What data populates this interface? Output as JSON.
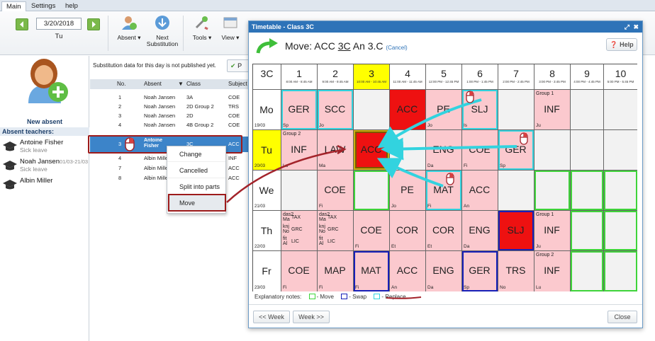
{
  "menu": {
    "tabs": [
      "Main",
      "Settings",
      "help"
    ]
  },
  "toolbar": {
    "date": "3/20/2018",
    "weekday": "Tu",
    "absent_label": "Absent",
    "next_substitution_label": "Next Substitution",
    "tools_label": "Tools",
    "view_label": "View"
  },
  "left": {
    "new_absent_label": "New absent",
    "absent_teachers_header": "Absent teachers:",
    "teachers": [
      {
        "name": "Antoine Fisher",
        "reason": "Sick leave",
        "dates": ""
      },
      {
        "name": "Noah Jansen",
        "reason": "Sick leave",
        "dates": "01/03-21/03"
      },
      {
        "name": "Albin Miller",
        "reason": "",
        "dates": ""
      }
    ]
  },
  "center": {
    "info": "Substitution data for this day is not published yet.",
    "publish_label": "P",
    "columns": [
      "No.",
      "Absent",
      "Class",
      "Subject"
    ],
    "rows": [
      {
        "no": "1",
        "absent": "Noah Jansen",
        "cls": "3A",
        "subject": "COE"
      },
      {
        "no": "2",
        "absent": "Noah Jansen",
        "cls": "2D Group 2",
        "subject": "TRS"
      },
      {
        "no": "3",
        "absent": "Noah Jansen",
        "cls": "2D",
        "subject": "COE"
      },
      {
        "no": "4",
        "absent": "Noah Jansen",
        "cls": "4B Group 2",
        "subject": "COE"
      },
      {
        "no": "3",
        "absent": "Antoine Fisher",
        "cls": "3C",
        "subject": "ACC"
      },
      {
        "no": "4",
        "absent": "Albin Mille",
        "cls": "",
        "subject": "INF"
      },
      {
        "no": "7",
        "absent": "Albin Mille",
        "cls": "",
        "subject": "ACC"
      },
      {
        "no": "8",
        "absent": "Albin Mille",
        "cls": "",
        "subject": "ACC"
      }
    ]
  },
  "context_menu": [
    "Change",
    "Cancelled",
    "Split into parts",
    "Move"
  ],
  "modal": {
    "title": "Timetable - Class 3C",
    "move_prefix": "Move: ACC ",
    "move_class": "3C",
    "move_suffix": " An 3.C ",
    "cancel_label": "(Cancel)",
    "help_label": "Help",
    "class_label": "3C",
    "periods": [
      {
        "n": "1",
        "t": "8:00 AM - 8:45 AM"
      },
      {
        "n": "2",
        "t": "9:00 AM - 9:45 AM"
      },
      {
        "n": "3",
        "t": "10:00 AM - 10:45 AM"
      },
      {
        "n": "4",
        "t": "11:00 AM - 11:45 AM"
      },
      {
        "n": "5",
        "t": "12:00 PM - 12:45 PM"
      },
      {
        "n": "6",
        "t": "1:00 PM - 1:45 PM"
      },
      {
        "n": "7",
        "t": "2:00 PM - 2:45 PM"
      },
      {
        "n": "8",
        "t": "3:00 PM - 3:45 PM"
      },
      {
        "n": "9",
        "t": "4:00 PM - 4:45 PM"
      },
      {
        "n": "10",
        "t": "5:00 PM - 5:45 PM"
      }
    ],
    "days": [
      {
        "d": "Mo",
        "date": "19/03"
      },
      {
        "d": "Tu",
        "date": "20/03"
      },
      {
        "d": "We",
        "date": "21/03"
      },
      {
        "d": "Th",
        "date": "22/03"
      },
      {
        "d": "Fr",
        "date": "23/03"
      }
    ],
    "lessons": {
      "mo1": {
        "s": "GER",
        "t": "Sp"
      },
      "mo2": {
        "s": "SCC",
        "t": "Jo"
      },
      "mo4": {
        "s": "ACC",
        "t": ""
      },
      "mo5": {
        "s": "PE",
        "t": "Jo"
      },
      "mo6": {
        "s": "SLJ",
        "t": "Is"
      },
      "mo8": {
        "s": "INF",
        "t": "Ju",
        "g": "Group 1"
      },
      "tu1": {
        "s": "INF",
        "t": "Lu",
        "g": "Group 2"
      },
      "tu2": {
        "s": "LAW",
        "t": "Ma"
      },
      "tu3": {
        "s": "ACC",
        "t": ""
      },
      "tu5": {
        "s": "ENG",
        "t": "Da"
      },
      "tu6": {
        "s": "COE",
        "t": "Fi"
      },
      "tu7": {
        "s": "GER",
        "t": "Sp"
      },
      "we2": {
        "s": "COE",
        "t": "Fi"
      },
      "we4": {
        "s": "PE",
        "t": "Jo"
      },
      "we5": {
        "s": "MAT",
        "t": "Fi"
      },
      "we6": {
        "s": "ACC",
        "t": "An"
      },
      "th3": {
        "s": "COE",
        "t": "Fi"
      },
      "th4": {
        "s": "COR",
        "t": "Et"
      },
      "th5": {
        "s": "COR",
        "t": "Et"
      },
      "th6": {
        "s": "ENG",
        "t": "Da"
      },
      "th7": {
        "s": "SLJ",
        "t": ""
      },
      "th8": {
        "s": "INF",
        "t": "Ju",
        "g": "Group 1"
      },
      "th1": {
        "a1": "das2",
        "a2": "TAX",
        "a3": "Ma",
        "b1": "knj",
        "b2": "GRC",
        "b3": "No",
        "c1": "fit",
        "c2": "LIC",
        "c3": "Al"
      },
      "th2": {
        "a1": "das2",
        "a2": "TAX",
        "a3": "Ma",
        "b1": "knj",
        "b2": "GRC",
        "b3": "No",
        "c1": "fit",
        "c2": "LIC",
        "c3": "Al"
      },
      "fr1": {
        "s": "COE",
        "t": "Fi"
      },
      "fr2": {
        "s": "MAP",
        "t": "Fi"
      },
      "fr3": {
        "s": "MAT",
        "t": "Fi"
      },
      "fr4": {
        "s": "ACC",
        "t": "An"
      },
      "fr5": {
        "s": "ENG",
        "t": "Da"
      },
      "fr6": {
        "s": "GER",
        "t": "Sp"
      },
      "fr7": {
        "s": "TRS",
        "t": "No"
      },
      "fr8": {
        "s": "INF",
        "t": "Lu",
        "g": "Group 2"
      }
    },
    "legend": {
      "label": "Explanatory notes:",
      "move": "- Move",
      "swap": "- Swap",
      "replace": "- Replace"
    },
    "prev_week": "<< Week",
    "next_week": "Week >>",
    "close": "Close"
  },
  "colors": {
    "accent": "#2e73b8",
    "lesson": "#fbc9ce",
    "highlight_red": "#ee1111",
    "move": "#3fd43a",
    "swap": "#1820b8",
    "replace": "#32d3df",
    "today": "#ffff00"
  }
}
